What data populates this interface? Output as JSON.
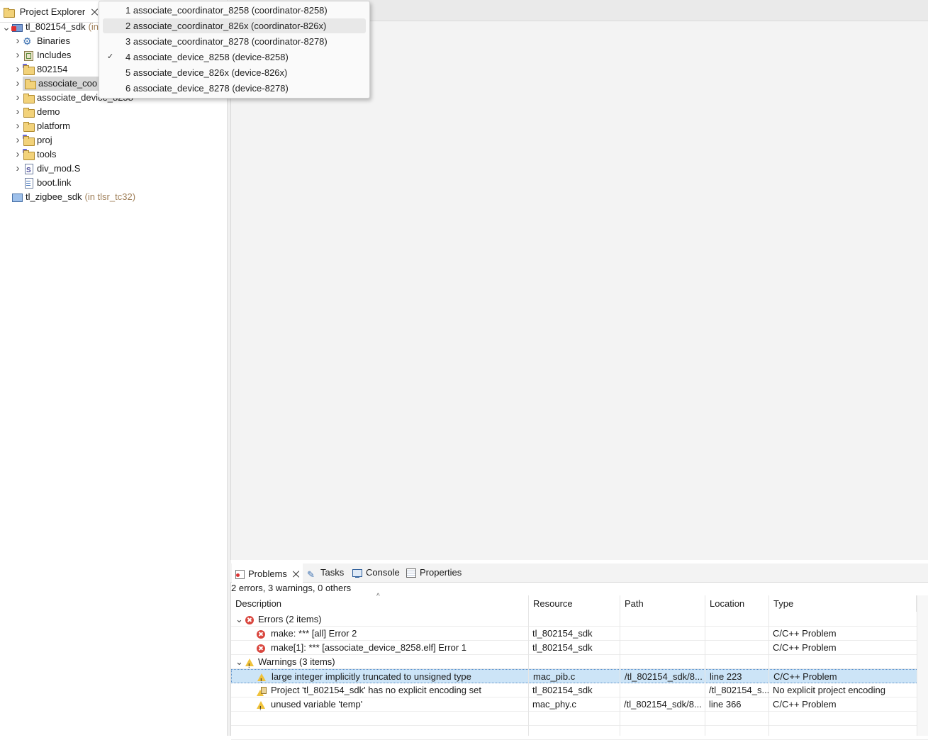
{
  "project_explorer": {
    "tab_title": "Project Explorer",
    "tree": [
      {
        "label": "tl_802154_sdk",
        "suffix": "(in",
        "icon": "project-error-icon",
        "chevron": "expanded"
      },
      {
        "label": "Binaries",
        "icon": "binaries-icon",
        "chevron": "collapsed"
      },
      {
        "label": "Includes",
        "icon": "includes-icon",
        "chevron": "collapsed"
      },
      {
        "label": "802154",
        "icon": "source-folder-icon",
        "chevron": "collapsed"
      },
      {
        "label": "associate_coo",
        "icon": "folder-icon",
        "chevron": "collapsed",
        "selected": true
      },
      {
        "label": "associate_device_8258",
        "icon": "folder-icon",
        "chevron": "collapsed"
      },
      {
        "label": "demo",
        "icon": "folder-icon",
        "chevron": "collapsed"
      },
      {
        "label": "platform",
        "icon": "folder-icon",
        "chevron": "collapsed"
      },
      {
        "label": "proj",
        "icon": "source-folder-icon",
        "chevron": "collapsed"
      },
      {
        "label": "tools",
        "icon": "source-folder-icon",
        "chevron": "collapsed"
      },
      {
        "label": "div_mod.S",
        "icon": "assembly-file-icon",
        "chevron": "collapsed"
      },
      {
        "label": "boot.link",
        "icon": "file-icon",
        "chevron": "none"
      },
      {
        "label": "tl_zigbee_sdk",
        "suffix": "(in tlsr_tc32)",
        "icon": "closed-project-icon",
        "chevron": "none"
      }
    ]
  },
  "build_config_menu": {
    "items": [
      {
        "label": "1 associate_coordinator_8258 (coordinator-8258)",
        "checked": false,
        "hover": false
      },
      {
        "label": "2 associate_coordinator_826x (coordinator-826x)",
        "checked": false,
        "hover": true
      },
      {
        "label": "3 associate_coordinator_8278 (coordinator-8278)",
        "checked": false,
        "hover": false
      },
      {
        "label": "4 associate_device_8258 (device-8258)",
        "checked": true,
        "hover": false
      },
      {
        "label": "5 associate_device_826x (device-826x)",
        "checked": false,
        "hover": false
      },
      {
        "label": "6 associate_device_8278 (device-8278)",
        "checked": false,
        "hover": false
      }
    ]
  },
  "bottom_panel": {
    "tabs": [
      {
        "label": "Problems",
        "icon": "problems-icon",
        "active": true
      },
      {
        "label": "Tasks",
        "icon": "tasks-icon",
        "active": false
      },
      {
        "label": "Console",
        "icon": "console-icon",
        "active": false
      },
      {
        "label": "Properties",
        "icon": "properties-icon",
        "active": false
      }
    ],
    "summary": "2 errors, 3 warnings, 0 others",
    "columns": [
      "Description",
      "Resource",
      "Path",
      "Location",
      "Type"
    ],
    "groups": [
      {
        "label": "Errors (2 items)",
        "icon": "error-icon",
        "rows": [
          {
            "description": "make: *** [all] Error 2",
            "resource": "tl_802154_sdk",
            "path": "",
            "location": "",
            "type": "C/C++ Problem",
            "icon": "error-icon"
          },
          {
            "description": "make[1]: *** [associate_device_8258.elf] Error 1",
            "resource": "tl_802154_sdk",
            "path": "",
            "location": "",
            "type": "C/C++ Problem",
            "icon": "error-icon"
          }
        ]
      },
      {
        "label": "Warnings (3 items)",
        "icon": "warning-icon",
        "rows": [
          {
            "description": "large integer implicitly truncated to unsigned type",
            "resource": "mac_pib.c",
            "path": "/tl_802154_sdk/8...",
            "location": "line 223",
            "type": "C/C++ Problem",
            "icon": "warning-icon",
            "selected": true
          },
          {
            "description": "Project 'tl_802154_sdk' has no explicit encoding set",
            "resource": "tl_802154_sdk",
            "path": "",
            "location": "/tl_802154_s...",
            "type": "No explicit project encoding",
            "icon": "encoding-warning-icon"
          },
          {
            "description": "unused variable 'temp'",
            "resource": "mac_phy.c",
            "path": "/tl_802154_sdk/8...",
            "location": "line 366",
            "type": "C/C++ Problem",
            "icon": "warning-icon"
          }
        ]
      }
    ]
  }
}
